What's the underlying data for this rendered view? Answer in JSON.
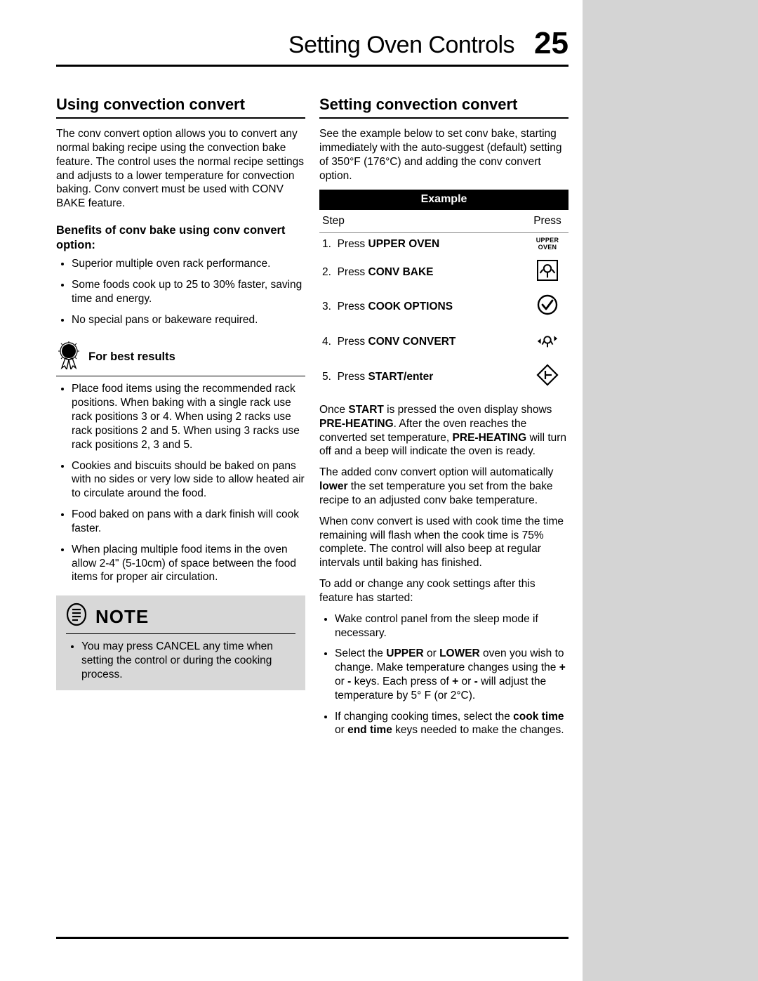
{
  "header": {
    "title": "Setting Oven Controls",
    "page": "25"
  },
  "left": {
    "h2": "Using convection convert",
    "intro": "The conv convert option allows you to convert any normal baking recipe using the convection bake feature. The control uses the normal recipe settings and adjusts to a lower temperature for convection baking. Conv convert must be used with CONV BAKE feature.",
    "benefits_h": "Benefits of conv bake using conv convert option:",
    "benefits": [
      "Superior multiple oven rack performance.",
      "Some foods cook up to 25 to 30% faster, saving time and energy.",
      "No special pans or bakeware required."
    ],
    "best_h": "For best results",
    "best": [
      "Place food items using the recommended rack positions. When baking with a single rack use rack positions 3 or 4. When using 2 racks use rack positions 2 and 5. When using 3 racks use rack positions 2, 3 and 5.",
      "Cookies and biscuits should be baked on pans with no sides or very low side to allow heated air to circulate around the food.",
      "Food baked on pans with a dark finish will cook faster.",
      "When placing multiple food items in the oven allow 2-4\" (5-10cm) of space between the food items for proper air circulation."
    ],
    "note_h": "NOTE",
    "note": [
      "You may press CANCEL any time when setting the control or during the cooking process."
    ]
  },
  "right": {
    "h2": "Setting convection convert",
    "intro": "See the example below to set conv bake, starting immediately with the auto-suggest (default) setting of 350°F (176°C) and adding the conv convert option.",
    "table": {
      "header": "Example",
      "step_label": "Step",
      "press_label": "Press",
      "rows": [
        {
          "n": "1.",
          "pre": "Press ",
          "bold": "UPPER OVEN",
          "icon": "upper-oven"
        },
        {
          "n": "2.",
          "pre": "Press ",
          "bold": "CONV BAKE",
          "icon": "conv-bake"
        },
        {
          "n": "3.",
          "pre": "Press ",
          "bold": "COOK OPTIONS",
          "icon": "cook-options"
        },
        {
          "n": "4.",
          "pre": "Press ",
          "bold": "CONV CONVERT",
          "icon": "conv-convert"
        },
        {
          "n": "5.",
          "pre": "Press ",
          "bold": "START/enter",
          "icon": "start"
        }
      ]
    },
    "p1_a": "Once ",
    "p1_b": "START",
    "p1_c": " is pressed the oven display shows ",
    "p1_d": "PRE-HEATING",
    "p1_e": ". After the oven reaches the converted set temperature, ",
    "p1_f": "PRE-HEATING",
    "p1_g": " will turn off and a beep will indicate the oven is ready.",
    "p2_a": "The added conv convert option will automatically ",
    "p2_b": "lower",
    "p2_c": " the set temperature you set from the bake recipe to an adjusted conv bake temperature.",
    "p3": "When conv convert is used with cook time the time remaining will flash when the cook time is 75% complete. The control will also beep at regular intervals until baking has finished.",
    "p4": "To add or change any cook settings after this feature has started:",
    "list": {
      "i1": "Wake control panel from the sleep mode if necessary.",
      "i2_a": "Select the ",
      "i2_b": "UPPER",
      "i2_c": " or ",
      "i2_d": "LOWER",
      "i2_e": " oven you wish to change. Make temperature changes using the ",
      "i2_f": "+",
      "i2_g": " or ",
      "i2_h": "-",
      "i2_i": " keys. Each press of ",
      "i2_j": "+",
      "i2_k": " or ",
      "i2_l": "-",
      "i2_m": " will adjust the temperature by 5° F (or 2°C).",
      "i3_a": "If changing cooking times, select the ",
      "i3_b": "cook time",
      "i3_c": " or ",
      "i3_d": "end time",
      "i3_e": " keys needed to make the changes."
    }
  }
}
